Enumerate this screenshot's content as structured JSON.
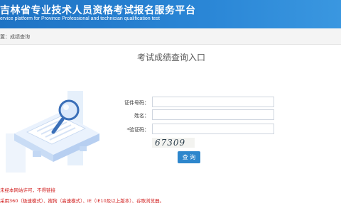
{
  "header": {
    "title": "吉林省专业技术人员资格考试报名服务平台",
    "subtitle": "ervice platform for Province Professional and technician qualification test"
  },
  "breadcrumb": {
    "prefix": "置：",
    "current": "成绩查询"
  },
  "main": {
    "title": "考试成绩查询入口",
    "fields": {
      "id_label": "证件号码：",
      "name_label": "姓名：",
      "captcha_label": "*验证码：",
      "id_value": "",
      "name_value": "",
      "captcha_value": ""
    },
    "captcha_text": "67309",
    "submit_label": "查 询"
  },
  "notices": {
    "line1": "未经本网站许可，不得链接",
    "line2": "采用360（极速模式）、搜狗（高速模式）、IE（IE10及以上版本）、谷歌浏览器。"
  },
  "colors": {
    "header_blue": "#2a86d6",
    "button_blue": "#2d86cc",
    "notice_red": "#d01a1a"
  }
}
